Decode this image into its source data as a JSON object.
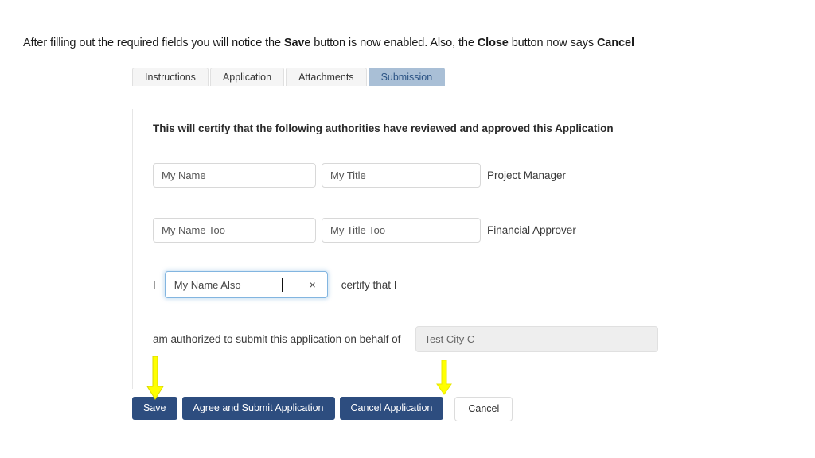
{
  "caption": {
    "part1": "After filling out the required fields you will notice the ",
    "bold1": "Save",
    "part2": " button is now enabled. Also, the ",
    "bold2": "Close",
    "part3": " button now says ",
    "bold3": "Cancel"
  },
  "tabs": [
    {
      "label": "Instructions",
      "active": false
    },
    {
      "label": "Application",
      "active": false
    },
    {
      "label": "Attachments",
      "active": false
    },
    {
      "label": "Submission",
      "active": true
    }
  ],
  "form": {
    "heading": "This will certify that the following authorities have reviewed and approved this Application",
    "rows": [
      {
        "name_value": "My Name",
        "title_value": "My Title",
        "role_label": "Project Manager"
      },
      {
        "name_value": "My Name Too",
        "title_value": "My Title Too",
        "role_label": "Financial Approver"
      }
    ],
    "certify": {
      "prefix": "I",
      "value": "My Name Also",
      "clear_icon": "×",
      "suffix": "certify that I"
    },
    "behalf": {
      "text": "am authorized to submit this application on behalf of",
      "org_value": "Test City C"
    }
  },
  "buttons": [
    {
      "label": "Save",
      "style": "primary"
    },
    {
      "label": "Agree and Submit Application",
      "style": "primary"
    },
    {
      "label": "Cancel Application",
      "style": "primary"
    },
    {
      "label": "Cancel",
      "style": "ghost"
    }
  ],
  "annotations": [
    {
      "name": "arrow-pointing-to-save",
      "icon": "down-arrow"
    },
    {
      "name": "arrow-pointing-to-cancel",
      "icon": "down-arrow"
    }
  ],
  "colors": {
    "primary_button": "#2d4d7f",
    "active_tab": "#a9bfd6",
    "active_tab_text": "#2b5384",
    "annotation_arrow": "#ffff00",
    "focus_border": "#82b5e0"
  }
}
